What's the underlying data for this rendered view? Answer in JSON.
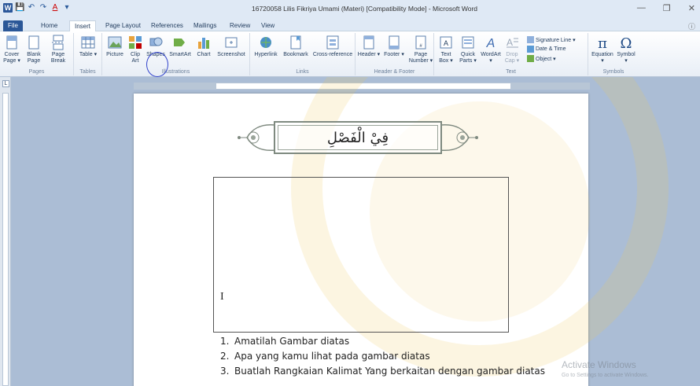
{
  "window": {
    "title": "16720058 Lilis Fikriya Umami (Materi) [Compatibility Mode] - Microsoft Word",
    "qat": [
      "W",
      "💾",
      "↶",
      "↷",
      "A",
      "▾"
    ],
    "min_icon": "—",
    "restore_icon": "❐",
    "close_icon": "✕"
  },
  "tabs": [
    "File",
    "Home",
    "Insert",
    "Page Layout",
    "References",
    "Mailings",
    "Review",
    "View"
  ],
  "active_tab": "Insert",
  "ribbon": {
    "pages": {
      "label": "Pages",
      "buttons": [
        "Cover Page ▾",
        "Blank Page",
        "Page Break"
      ]
    },
    "tables": {
      "label": "Tables",
      "buttons": [
        "Table ▾"
      ]
    },
    "illustrations": {
      "label": "Illustrations",
      "buttons": [
        "Picture",
        "Clip Art",
        "Shapes",
        "SmartArt",
        "Chart",
        "Screenshot"
      ]
    },
    "links": {
      "label": "Links",
      "buttons": [
        "Hyperlink",
        "Bookmark",
        "Cross-reference"
      ]
    },
    "header_footer": {
      "label": "Header & Footer",
      "buttons": [
        "Header ▾",
        "Footer ▾",
        "Page Number ▾"
      ]
    },
    "text": {
      "label": "Text",
      "buttons": [
        "Text Box ▾",
        "Quick Parts ▾",
        "WordArt ▾",
        "Drop Cap ▾"
      ],
      "small": [
        "Signature Line ▾",
        "Date & Time",
        "Object ▾"
      ]
    },
    "symbols": {
      "label": "Symbols",
      "buttons": [
        "Equation ▾",
        "Symbol ▾"
      ]
    }
  },
  "document": {
    "heading_arabic": "فِيْ الْفَصْلِ",
    "cursor": "I",
    "list": [
      {
        "n": "1.",
        "text": "Amatilah Gambar diatas"
      },
      {
        "n": "2.",
        "text": "Apa yang kamu lihat pada gambar diatas"
      },
      {
        "n": "3.",
        "text": "Buatlah Rangkaian Kalimat Yang berkaitan dengan gambar diatas"
      }
    ]
  },
  "overlay": {
    "activate": "Activate Windows",
    "activate_sub": "Go to Settings to activate Windows."
  },
  "colors": {
    "accent": "#2b579a",
    "ribbon_bg": "#dfe9f5",
    "doc_bg": "#abbdd5"
  }
}
